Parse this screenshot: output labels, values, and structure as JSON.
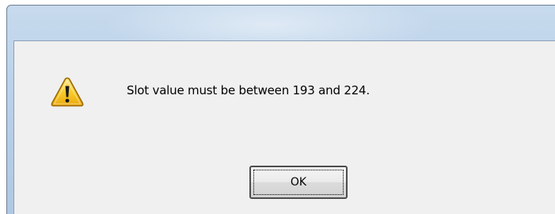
{
  "dialog": {
    "message": "Slot value must be between 193 and 224.",
    "icon": "warning-icon",
    "ok_label": "OK"
  },
  "colors": {
    "titlebar": "#b9d1ea",
    "client_background": "#f0f0f0",
    "warning_fill": "#f7c928",
    "button_border": "#4d4d4d"
  }
}
